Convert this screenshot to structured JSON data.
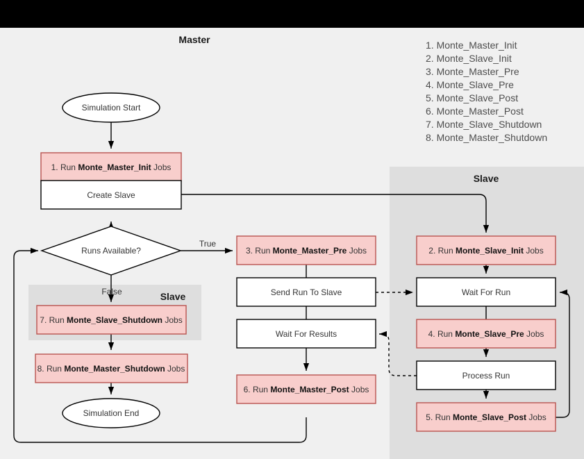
{
  "canvas": {
    "background": "#f0f0f0",
    "topbar_color": "#000000",
    "process_fill": "#f8cecc",
    "process_stroke": "#b85450",
    "plain_fill": "#ffffff",
    "plain_stroke": "#000000",
    "lane_fill": "#dedede",
    "line_color": "#000000"
  },
  "lanes": {
    "master_title": "Master",
    "slave_title_right": "Slave",
    "slave_title_left": "Slave"
  },
  "legend": {
    "items": [
      "1. Monte_Master_Init",
      "2. Monte_Slave_Init",
      "3. Monte_Master_Pre",
      "4. Monte_Slave_Pre",
      "5. Monte_Slave_Post",
      "6. Monte_Master_Post",
      "7. Monte_Slave_Shutdown",
      "8. Monte_Master_Shutdown"
    ]
  },
  "nodes": {
    "start": {
      "label": "Simulation Start"
    },
    "step1": {
      "prefix": "1. Run ",
      "bold": "Monte_Master_Init",
      "suffix": " Jobs"
    },
    "create_slave": {
      "label": "Create Slave"
    },
    "decision": {
      "label": "Runs Available?"
    },
    "step3": {
      "prefix": "3. Run ",
      "bold": "Monte_Master_Pre",
      "suffix": " Jobs"
    },
    "send_run": {
      "label": "Send Run To Slave"
    },
    "wait_results": {
      "label": "Wait For Results"
    },
    "step6": {
      "prefix": "6. Run ",
      "bold": "Monte_Master_Post",
      "suffix": " Jobs"
    },
    "step2": {
      "prefix": "2. Run ",
      "bold": "Monte_Slave_Init",
      "suffix": " Jobs"
    },
    "wait_run": {
      "label": "Wait For Run"
    },
    "step4": {
      "prefix": "4. Run ",
      "bold": "Monte_Slave_Pre",
      "suffix": " Jobs"
    },
    "process_run": {
      "label": "Process Run"
    },
    "step5": {
      "prefix": "5. Run ",
      "bold": "Monte_Slave_Post",
      "suffix": " Jobs"
    },
    "step7": {
      "prefix": "7. Run ",
      "bold": "Monte_Slave_Shutdown",
      "suffix": " Jobs"
    },
    "step8": {
      "prefix": "8. Run ",
      "bold": "Monte_Master_Shutdown",
      "suffix": " Jobs"
    },
    "end": {
      "label": "Simulation End"
    }
  },
  "edge_labels": {
    "true_label": "True",
    "false_label": "False"
  }
}
